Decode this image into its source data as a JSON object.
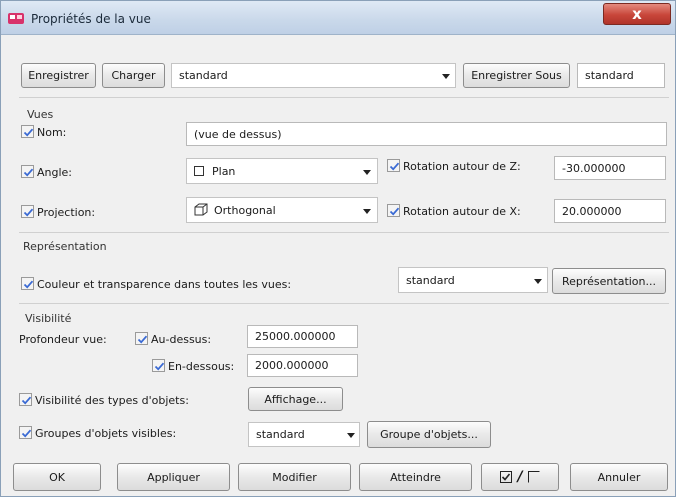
{
  "window": {
    "title": "Propriétés de la vue",
    "close_label": "x"
  },
  "toolbar": {
    "save_label": "Enregistrer",
    "load_label": "Charger",
    "preset_value": "standard",
    "save_as_label": "Enregistrer Sous",
    "save_as_name": "standard"
  },
  "views": {
    "section_label": "Vues",
    "name_label": "Nom:",
    "name_value": "(vue de dessus)",
    "angle_label": "Angle:",
    "angle_value": "Plan",
    "rotation_z_label": "Rotation autour de Z:",
    "rotation_z_value": "-30.000000",
    "projection_label": "Projection:",
    "projection_value": "Orthogonal",
    "rotation_x_label": "Rotation autour de X:",
    "rotation_x_value": "20.000000"
  },
  "representation": {
    "section_label": "Représentation",
    "color_label": "Couleur et transparence dans toutes les vues:",
    "color_value": "standard",
    "button_label": "Représentation..."
  },
  "visibility": {
    "section_label": "Visibilité",
    "depth_label": "Profondeur vue:",
    "above_label": "Au-dessus:",
    "above_value": "25000.000000",
    "below_label": "En-dessous:",
    "below_value": "2000.000000",
    "types_label": "Visibilité des types d'objets:",
    "display_button": "Affichage...",
    "groups_label": "Groupes d'objets visibles:",
    "groups_value": "standard",
    "groups_button": "Groupe d'objets..."
  },
  "footer": {
    "ok_label": "OK",
    "apply_label": "Appliquer",
    "modify_label": "Modifier",
    "reach_label": "Atteindre",
    "toggle_separator": "/",
    "cancel_label": "Annuler"
  },
  "colors": {
    "titlebar": "#c9d8ea",
    "close": "#c8463a",
    "dialog": "#f0f0f0"
  },
  "icons": [
    "app-icon",
    "close-icon",
    "checkbox-checked-icon",
    "square-icon",
    "cube-icon",
    "chevron-down-icon"
  ]
}
